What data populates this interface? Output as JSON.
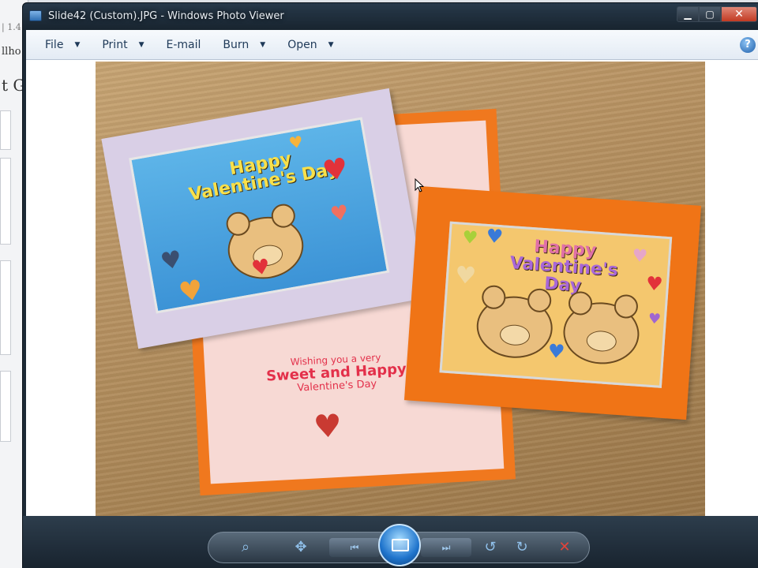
{
  "background_window": {
    "fragments": [
      "| 1.4",
      "llho",
      "t Ga"
    ]
  },
  "window": {
    "title": "Slide42 (Custom).JPG - Windows Photo Viewer",
    "caption_buttons": {
      "minimize": "▁",
      "maximize": "▢",
      "close": "✕"
    }
  },
  "menubar": {
    "items": [
      {
        "label": "File",
        "arrow": "▼"
      },
      {
        "label": "Print",
        "arrow": "▼"
      },
      {
        "label": "E-mail",
        "arrow": ""
      },
      {
        "label": "Burn",
        "arrow": "▼"
      },
      {
        "label": "Open",
        "arrow": "▼"
      }
    ],
    "help": "?"
  },
  "photo": {
    "card_left": {
      "line1": "Happy",
      "line2": "Valentine's Day"
    },
    "card_right": {
      "line1": "Happy",
      "line2": "Valentine's Day"
    },
    "inside": {
      "line1": "Wishing you a very",
      "line2": "Sweet and Happy",
      "line3": "Valentine's Day"
    }
  },
  "controls": {
    "zoom_icon": "⌕",
    "actual_size_icon": "✥",
    "previous_icon": "⏮",
    "slideshow_icon": "slideshow-icon",
    "next_icon": "⏭",
    "rotate_ccw_icon": "↺",
    "rotate_cw_icon": "↻",
    "delete_icon": "✕"
  },
  "colors": {
    "titlebar": "#1d2a36",
    "menubar": "#e3ebf4",
    "accent_blue": "#1f74cc",
    "delete_red": "#e0443a"
  }
}
